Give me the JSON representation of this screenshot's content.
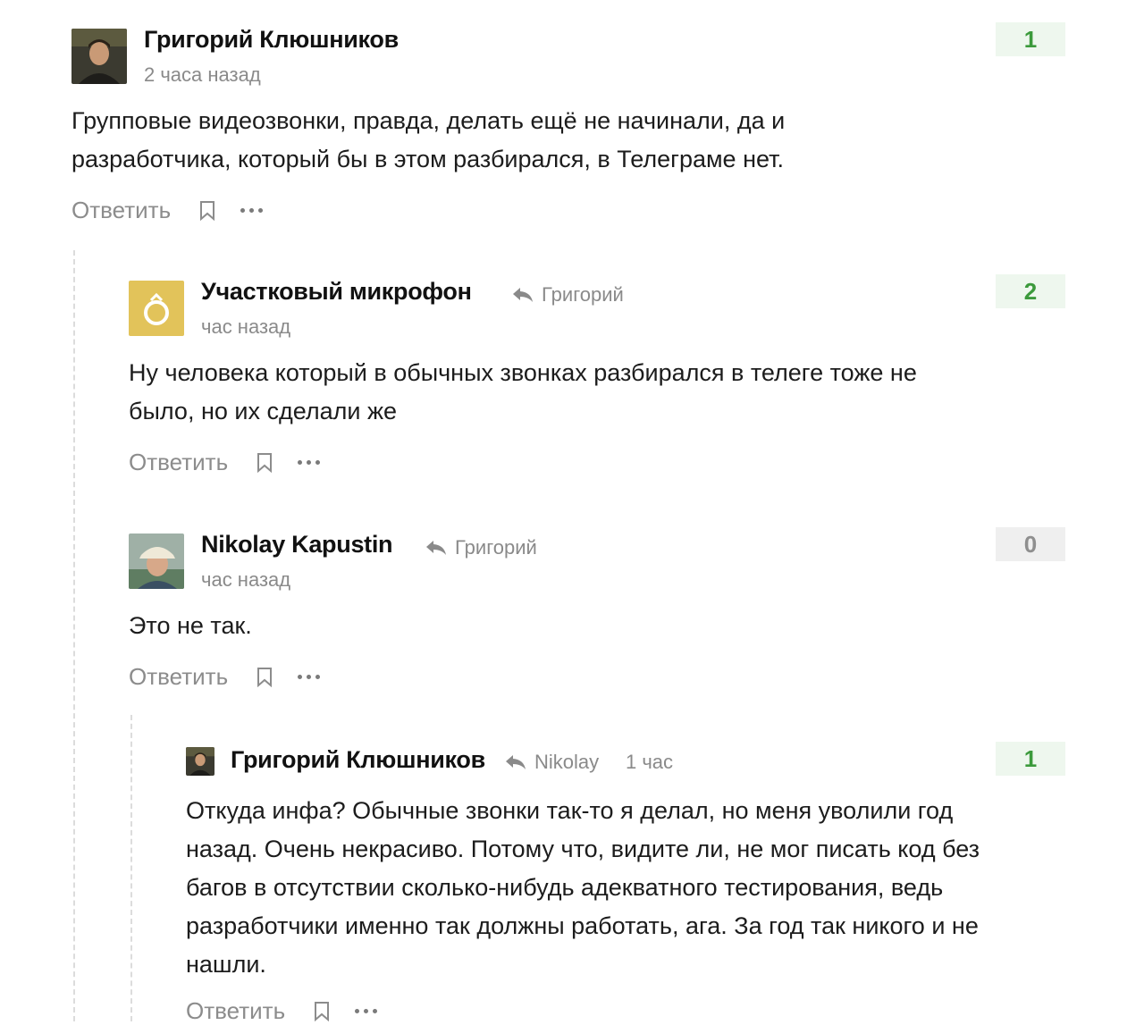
{
  "comments": [
    {
      "author": "Григорий Клюшников",
      "time": "2 часа назад",
      "score": "1",
      "text": "Групповые видеозвонки, правда, делать ещё не начинали, да и разработчика, который бы в этом разбирался, в Телеграме нет.",
      "reply_label": "Ответить"
    },
    {
      "author": "Участковый микрофон",
      "reply_to": "Григорий",
      "time": "час назад",
      "score": "2",
      "text": "Ну человека который в обычных звонках разбирался в телеге тоже не было, но их сделали же",
      "reply_label": "Ответить"
    },
    {
      "author": "Nikolay Kapustin",
      "reply_to": "Григорий",
      "time": "час назад",
      "score": "0",
      "text": "Это не так.",
      "reply_label": "Ответить"
    },
    {
      "author": "Григорий Клюшников",
      "reply_to": "Nikolay",
      "time": "1 час",
      "score": "1",
      "text": "Откуда инфа? Обычные звонки так-то я делал, но меня уволили год назад. Очень некрасиво. Потому что, видите ли, не мог писать код без багов в отсутствии сколько-нибудь адекватного тестирования, ведь разработчики именно так должны работать, ага. За год так никого и не нашли.",
      "reply_label": "Ответить"
    }
  ],
  "colors": {
    "score_positive_bg": "#eef7ee",
    "score_positive_text": "#3c9a3c",
    "score_neutral_bg": "#efefef",
    "score_neutral_text": "#8f8f8f",
    "avatar_mic_bg": "#e2c35a"
  },
  "icons": {
    "reply_arrow": "reply-arrow-icon",
    "bookmark": "bookmark-icon",
    "more": "more-dots-icon",
    "ring": "ring-icon"
  }
}
